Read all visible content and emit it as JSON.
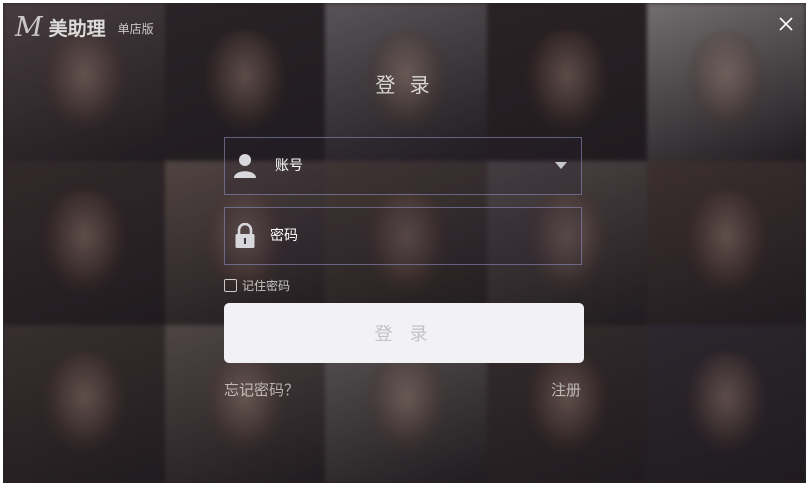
{
  "app": {
    "logo_mark": "M",
    "name": "美助理",
    "edition": "单店版"
  },
  "login": {
    "title": "登 录",
    "account_value": "账号",
    "password_value": "密码",
    "remember_label": "记住密码",
    "remember_checked": false,
    "submit_label": "登 录",
    "forgot_label": "忘记密码？",
    "register_label": "注册"
  },
  "icons": {
    "close": "close-icon",
    "user": "user-icon",
    "lock": "lock-icon",
    "dropdown": "dropdown-arrow-icon"
  },
  "colors": {
    "submit_bg": "#f2f2f4",
    "submit_text": "#c2c2c8",
    "field_border": "#8f8fbf"
  },
  "background_tiles": [
    "#6e5d5e",
    "#3a3133",
    "#8a8487",
    "#3b2f30",
    "#b8b3b2",
    "#4a3b3a",
    "#7d6a62",
    "#6a5a4c",
    "#766a66",
    "#5a4643",
    "#534641",
    "#7a6d67",
    "#8d8783",
    "#4d3f3d",
    "#3f3841"
  ]
}
